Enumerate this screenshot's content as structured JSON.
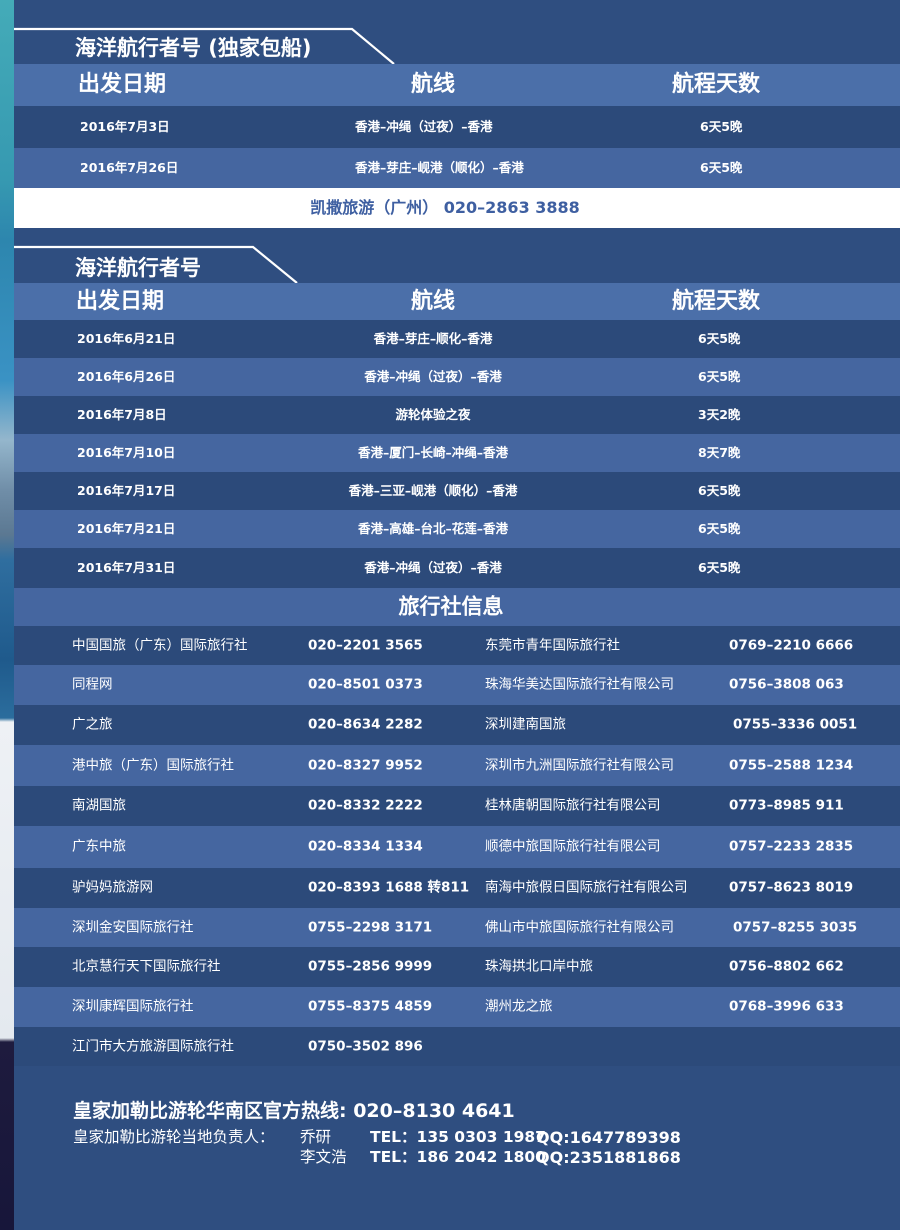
{
  "cruise_charter": {
    "title": "海洋航行者号 (独家包船)",
    "headers": {
      "date": "出发日期",
      "route": "航线",
      "duration": "航程天数"
    },
    "rows": [
      {
        "date": "2016年7月3日",
        "route": "香港–冲绳（过夜）–香港",
        "duration": "6天5晚"
      },
      {
        "date": "2016年7月26日",
        "route": "香港–芽庄–岘港（顺化）–香港",
        "duration": "6天5晚"
      }
    ]
  },
  "charter_agent": "凯撒旅游（广州） 020–2863 3888",
  "cruise_regular": {
    "title": "海洋航行者号",
    "headers": {
      "date": "出发日期",
      "route": "航线",
      "duration": "航程天数"
    },
    "rows": [
      {
        "date": "2016年6月21日",
        "route": "香港–芽庄–顺化–香港",
        "duration": "6天5晚"
      },
      {
        "date": "2016年6月26日",
        "route": "香港–冲绳（过夜）–香港",
        "duration": "6天5晚"
      },
      {
        "date": "2016年7月8日",
        "route": "游轮体验之夜",
        "duration": "3天2晚"
      },
      {
        "date": "2016年7月10日",
        "route": "香港–厦门–长崎–冲绳–香港",
        "duration": "8天7晚"
      },
      {
        "date": "2016年7月17日",
        "route": "香港–三亚–岘港（顺化）–香港",
        "duration": "6天5晚"
      },
      {
        "date": "2016年7月21日",
        "route": "香港–高雄–台北–花莲–香港",
        "duration": "6天5晚"
      },
      {
        "date": "2016年7月31日",
        "route": "香港–冲绳（过夜）–香港",
        "duration": "6天5晚"
      }
    ]
  },
  "agencies": {
    "title": "旅行社信息",
    "rows": [
      [
        {
          "name": "中国国旅（广东）国际旅行社",
          "phone": "020–2201 3565"
        },
        {
          "name": "东莞市青年国际旅行社",
          "phone": "0769–2210 6666"
        }
      ],
      [
        {
          "name": "同程网",
          "phone": "020–8501 0373"
        },
        {
          "name": "珠海华美达国际旅行社有限公司",
          "phone": "0756–3808 063"
        }
      ],
      [
        {
          "name": "广之旅",
          "phone": "020–8634 2282"
        },
        {
          "name": "深圳建南国旅",
          "phone": "0755–3336 0051"
        }
      ],
      [
        {
          "name": "港中旅（广东）国际旅行社",
          "phone": "020–8327 9952"
        },
        {
          "name": "深圳市九洲国际旅行社有限公司",
          "phone": "0755–2588 1234"
        }
      ],
      [
        {
          "name": "南湖国旅",
          "phone": "020–8332 2222"
        },
        {
          "name": "桂林唐朝国际旅行社有限公司",
          "phone": "0773–8985 911"
        }
      ],
      [
        {
          "name": "广东中旅",
          "phone": "020–8334 1334"
        },
        {
          "name": "顺德中旅国际旅行社有限公司",
          "phone": "0757–2233 2835"
        }
      ],
      [
        {
          "name": "驴妈妈旅游网",
          "phone": "020–8393 1688 转811"
        },
        {
          "name": "南海中旅假日国际旅行社有限公司",
          "phone": "0757–8623 8019"
        }
      ],
      [
        {
          "name": "深圳金安国际旅行社",
          "phone": "0755–2298 3171"
        },
        {
          "name": "佛山市中旅国际旅行社有限公司",
          "phone": "0757–8255 3035"
        }
      ],
      [
        {
          "name": "北京慧行天下国际旅行社",
          "phone": "0755–2856 9999"
        },
        {
          "name": "珠海拱北口岸中旅",
          "phone": "0756–8802 662"
        }
      ],
      [
        {
          "name": "深圳康辉国际旅行社",
          "phone": "0755–8375 4859"
        },
        {
          "name": "潮州龙之旅",
          "phone": "0768–3996 633"
        }
      ],
      [
        {
          "name": "江门市大方旅游国际旅行社",
          "phone": "0750–3502 896"
        }
      ]
    ]
  },
  "footer": {
    "hotline": "皇家加勒比游轮华南区官方热线: 020–8130 4641",
    "contacts_label": "皇家加勒比游轮当地负责人：",
    "contacts": [
      {
        "name": "乔研",
        "tel": "TEL：135 0303 1987",
        "qq": "QQ:1647789398"
      },
      {
        "name": "李文浩",
        "tel": "TEL：186 2042 1800",
        "qq": "QQ:2351881868"
      }
    ]
  },
  "colors": {
    "background": "#2f4e80",
    "row_dark": "#2c4a7a",
    "row_light": "#4566a0",
    "header_row": "#4b6fa9",
    "agent_bar": "#ffffff",
    "agent_bar_text": "#3e5fa1",
    "text": "#ffffff"
  }
}
